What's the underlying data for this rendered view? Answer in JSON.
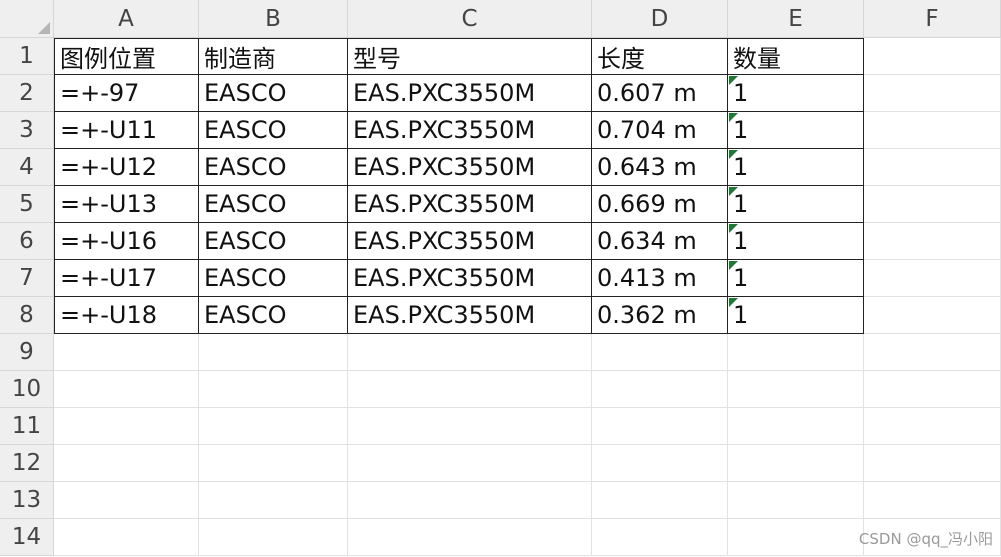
{
  "columns": [
    "A",
    "B",
    "C",
    "D",
    "E",
    "F"
  ],
  "rows": [
    "1",
    "2",
    "3",
    "4",
    "5",
    "6",
    "7",
    "8",
    "9",
    "10",
    "11",
    "12",
    "13",
    "14"
  ],
  "table": {
    "headers": [
      "图例位置",
      "制造商",
      "型号",
      "长度",
      "数量"
    ],
    "data": [
      [
        "=+-97",
        "EASCO",
        "EAS.PXC3550M",
        "0.607 m",
        "1"
      ],
      [
        "=+-U11",
        "EASCO",
        "EAS.PXC3550M",
        "0.704 m",
        "1"
      ],
      [
        "=+-U12",
        "EASCO",
        "EAS.PXC3550M",
        "0.643 m",
        "1"
      ],
      [
        "=+-U13",
        "EASCO",
        "EAS.PXC3550M",
        "0.669 m",
        "1"
      ],
      [
        "=+-U16",
        "EASCO",
        "EAS.PXC3550M",
        "0.634 m",
        "1"
      ],
      [
        "=+-U17",
        "EASCO",
        "EAS.PXC3550M",
        "0.413 m",
        "1"
      ],
      [
        "=+-U18",
        "EASCO",
        "EAS.PXC3550M",
        "0.362 m",
        "1"
      ]
    ]
  },
  "watermark": "CSDN @qq_冯小阳",
  "colors": {
    "error_indicator": "#1e7a32",
    "header_bg": "#efefef"
  }
}
